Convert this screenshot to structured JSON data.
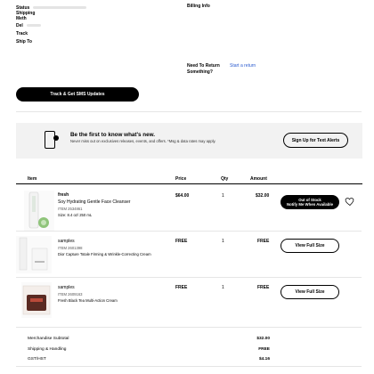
{
  "order_info": {
    "status_label": "Status",
    "shipping_method_label_1": "Shipping",
    "shipping_method_label_2": "Meth",
    "delivery_label": "Del",
    "tracking_label": "Track",
    "ship_to_label": "Ship To"
  },
  "billing": {
    "label": "Billing Info"
  },
  "returns": {
    "question_line1": "Need To Return",
    "question_line2": "Something?",
    "link_label": "Start a return"
  },
  "track_button": {
    "label": "Track & Get SMS Updates"
  },
  "sms_banner": {
    "title": "Be the first to know what's new.",
    "subtitle": "Never miss out on exclusives releases, events, and offers. *Msg & data rates may apply.",
    "button_label": "Sign Up for Text Alerts"
  },
  "table": {
    "headers": {
      "item": "Item",
      "price": "Price",
      "qty": "Qty",
      "amount": "Amount"
    },
    "rows": [
      {
        "brand": "fresh",
        "name": "Soy Hydrating Gentle Face Cleanser",
        "item_no": "ITEM 2534861",
        "size": "Size: 8.4 oz/ 250 mL",
        "price": "$64.00",
        "qty": "1",
        "amount": "$32.00",
        "action_line1": "Out of Stock",
        "action_line2": "Notify Me When Available"
      },
      {
        "brand": "samples",
        "name": "Dior Capture Totale Firming & Wrinkle-Correcting Cream",
        "item_no": "ITEM 2601398",
        "price": "FREE",
        "qty": "1",
        "amount": "FREE",
        "action_label": "View Full Size"
      },
      {
        "brand": "samples",
        "name": "Fresh Black Tea Multi-Action Cream",
        "item_no": "ITEM 2609163",
        "price": "FREE",
        "qty": "1",
        "amount": "FREE",
        "action_label": "View Full Size"
      }
    ]
  },
  "summary": {
    "subtotal_label": "Merchandise Subtotal",
    "subtotal_value": "$32.00",
    "shipping_label": "Shipping & Handling",
    "shipping_value": "FREE",
    "tax_label": "GST/HST",
    "tax_value": "$4.16"
  },
  "colors": {
    "link": "#2b5bd0",
    "banner_bg": "#f2f2f2",
    "primary": "#000000"
  },
  "icons": {
    "phone": "phone-sms-icon",
    "heart": "heart-icon"
  }
}
